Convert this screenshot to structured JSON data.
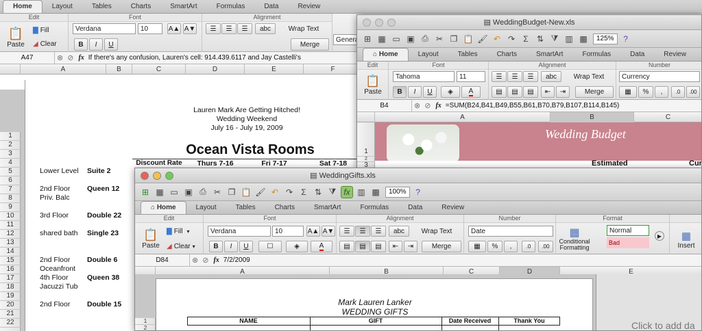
{
  "back": {
    "tabs": [
      "Home",
      "Layout",
      "Tables",
      "Charts",
      "SmartArt",
      "Formulas",
      "Data",
      "Review"
    ],
    "groups": {
      "edit": "Edit",
      "font": "Font",
      "alignment": "Alignment"
    },
    "ribbon": {
      "paste": "Paste",
      "fill": "Fill",
      "clear": "Clear",
      "font": "Verdana",
      "size": "10",
      "abc": "abc",
      "wrap": "Wrap Text",
      "merge": "Merge",
      "number_format": "General"
    },
    "formula": {
      "cell": "A47",
      "text": "If there's any confusion, Lauren's cell: 914.439.6117 and Jay Castelli's"
    },
    "columns": [
      "A",
      "B",
      "C",
      "D",
      "E",
      "F"
    ],
    "rows": [
      "1",
      "2",
      "3",
      "4",
      "5",
      "6",
      "7",
      "8",
      "9",
      "10",
      "11",
      "12",
      "13",
      "14",
      "15",
      "16",
      "17",
      "18",
      "19",
      "20",
      "21",
      "22"
    ],
    "header_line1": "Lauren Mark Are Getting Hitched!",
    "header_line2": "Wedding Weekend",
    "header_line3": "July 16 - July 19, 2009",
    "sheet_title": "Ocean Vista Rooms",
    "col_headers": [
      "Discount Rate",
      "Thurs 7-16",
      "Fri 7-17",
      "Sat 7-18"
    ],
    "rooms": [
      {
        "a": "Lower Level",
        "b": "Suite 2",
        "row": 5
      },
      {
        "a": "2nd Floor",
        "b": "Queen 12",
        "row": 7
      },
      {
        "a": "Priv. Balc",
        "b": "",
        "row": 8
      },
      {
        "a": "3rd Floor",
        "b": "Double 22",
        "row": 10
      },
      {
        "a": "shared bath",
        "b": "Single 23",
        "row": 12
      },
      {
        "a": "2nd Floor",
        "b": "Double 6",
        "row": 15
      },
      {
        "a": "Oceanfront",
        "b": "",
        "row": 16
      },
      {
        "a": "4th Floor",
        "b": "Queen 38",
        "row": 17
      },
      {
        "a": "Jacuzzi Tub",
        "b": "",
        "row": 18
      },
      {
        "a": "2nd Floor",
        "b": "Double 15",
        "row": 20
      }
    ]
  },
  "budget": {
    "title": "WeddingBudget-New.xls",
    "zoom": "125%",
    "tabs": [
      "Home",
      "Layout",
      "Tables",
      "Charts",
      "SmartArt",
      "Formulas",
      "Data",
      "Review"
    ],
    "groups": {
      "edit": "Edit",
      "font": "Font",
      "alignment": "Alignment",
      "number": "Number"
    },
    "ribbon": {
      "paste": "Paste",
      "font": "Tahoma",
      "size": "11",
      "abc": "abc",
      "wrap": "Wrap Text",
      "merge": "Merge",
      "number_format": "Currency",
      "percent": "%"
    },
    "formula": {
      "cell": "B4",
      "text": "=SUM(B24,B41,B49,B55,B61,B70,B79,B107,B114,B145)"
    },
    "columns": [
      "A",
      "B",
      "C"
    ],
    "rows": [
      "1",
      "2",
      "3"
    ],
    "banner_title": "Wedding Budget",
    "estimated": "Estimated",
    "current_partial": "Cur"
  },
  "gifts": {
    "title": "WeddingGifts.xls",
    "zoom": "100%",
    "tabs": [
      "Home",
      "Layout",
      "Tables",
      "Charts",
      "SmartArt",
      "Formulas",
      "Data",
      "Review"
    ],
    "groups": {
      "edit": "Edit",
      "font": "Font",
      "alignment": "Alignment",
      "number": "Number",
      "format": "Format"
    },
    "ribbon": {
      "paste": "Paste",
      "fill": "Fill",
      "clear": "Clear",
      "font": "Verdana",
      "size": "10",
      "abc": "abc",
      "wrap": "Wrap Text",
      "merge": "Merge",
      "number_format": "Date",
      "percent": "%",
      "cond_line1": "Conditional",
      "cond_line2": "Formatting",
      "style_normal": "Normal",
      "style_bad": "Bad",
      "insert": "Insert"
    },
    "formula": {
      "cell": "D84",
      "text": "7/2/2009"
    },
    "columns": [
      "A",
      "B",
      "C",
      "D",
      "E"
    ],
    "rows": [
      "1",
      "2"
    ],
    "names_line": "Mark Lauren Lanker",
    "subtitle": "WEDDING GIFTS",
    "table_headers": [
      "NAME",
      "GIFT",
      "Date Received",
      "Thank You"
    ],
    "slide_placeholder": "Click to add da"
  }
}
